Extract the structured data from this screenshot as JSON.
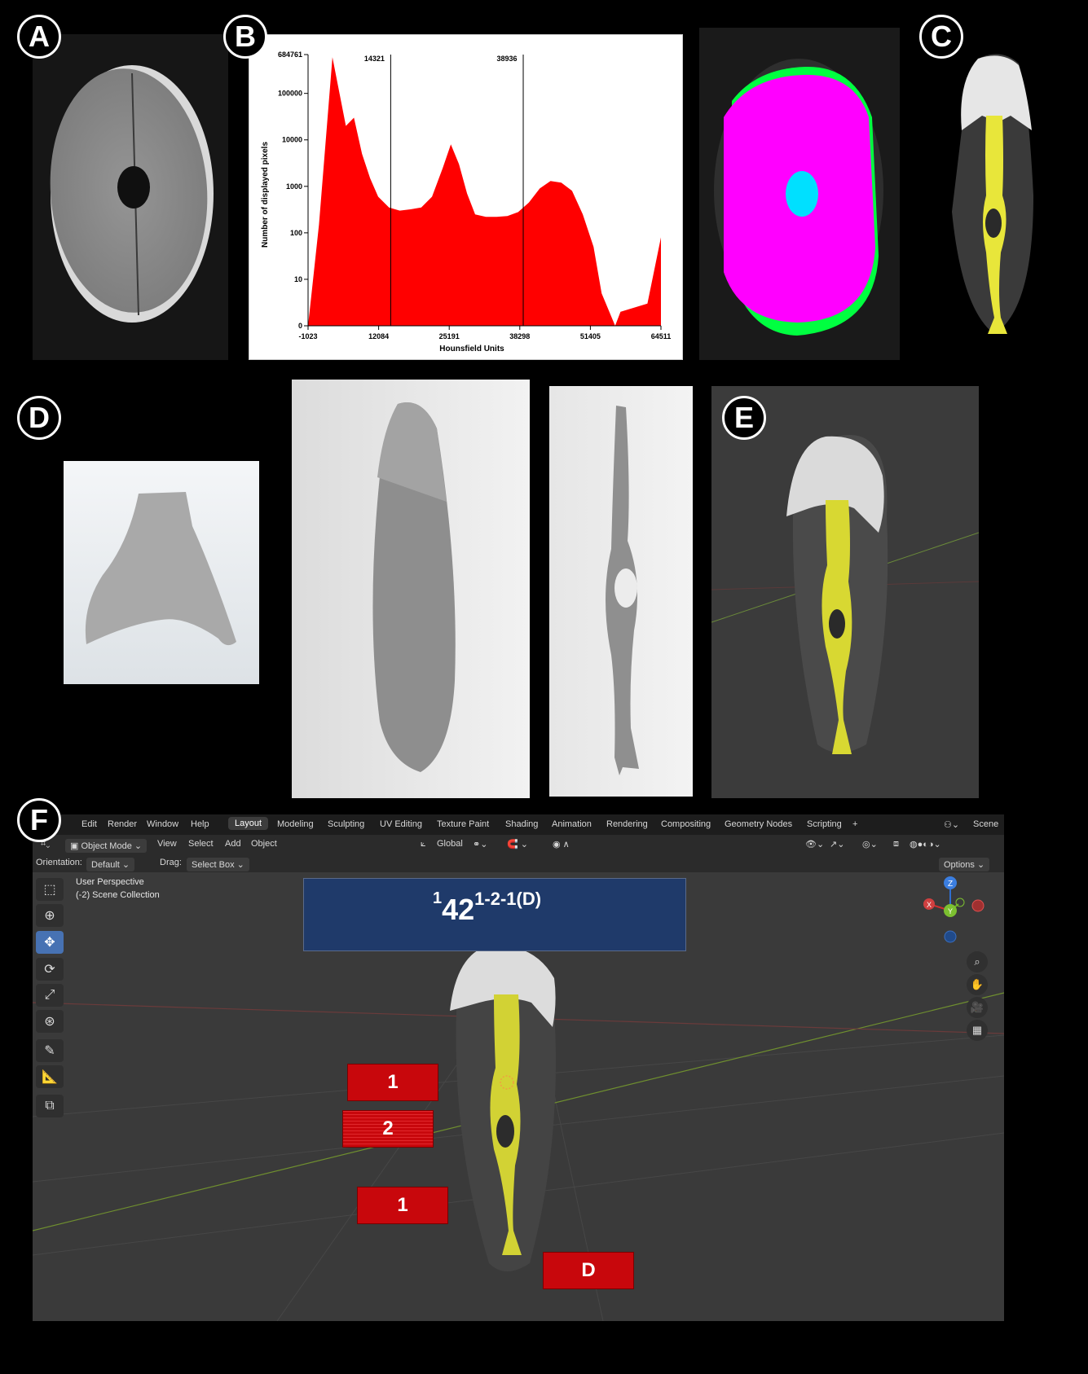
{
  "badges": {
    "a": "A",
    "b": "B",
    "c": "C",
    "d": "D",
    "e": "E",
    "f": "F"
  },
  "histogram": {
    "ylabel": "Number of displayed pixels",
    "xlabel": "Hounsfield Units",
    "y_ticks": [
      "684761",
      "100000",
      "10000",
      "1000",
      "100",
      "10",
      "0"
    ],
    "x_ticks": [
      "-1023",
      "12084",
      "25191",
      "38298",
      "51405",
      "64511"
    ],
    "thresholds": [
      "14321",
      "38936"
    ],
    "color": "#ff0000"
  },
  "chart_data": {
    "type": "area",
    "title": "",
    "xlabel": "Hounsfield Units",
    "ylabel": "Number of displayed pixels",
    "y_scale": "log",
    "xlim": [
      -1023,
      64511
    ],
    "ylim": [
      0,
      684761
    ],
    "x_ticks": [
      -1023,
      12084,
      25191,
      38298,
      51405,
      64511
    ],
    "y_ticks": [
      0,
      10,
      100,
      1000,
      10000,
      100000,
      684761
    ],
    "thresholds": [
      14321,
      38936
    ],
    "series": [
      {
        "x": [
          -1023,
          1000,
          3500,
          6000,
          7500,
          9000,
          10500,
          12000,
          14000,
          16000,
          18000,
          20000,
          22000,
          24000,
          25500,
          27000,
          28500,
          30000,
          32000,
          34000,
          36000,
          38000,
          40000,
          42000,
          44000,
          46000,
          48000,
          50000,
          52000,
          53500,
          56000,
          57000,
          62000,
          64511
        ],
        "y": [
          0,
          150,
          600000,
          20000,
          30000,
          5000,
          1500,
          600,
          350,
          300,
          320,
          350,
          600,
          2500,
          8000,
          3000,
          700,
          250,
          220,
          220,
          230,
          280,
          450,
          900,
          1300,
          1200,
          800,
          250,
          50,
          5,
          0,
          2,
          3,
          80
        ]
      }
    ],
    "color": "#ff0000"
  },
  "blender": {
    "menu": [
      "e",
      "Edit",
      "Render",
      "Window",
      "Help"
    ],
    "workspaces": [
      "Layout",
      "Modeling",
      "Sculpting",
      "UV Editing",
      "Texture Paint",
      "Shading",
      "Animation",
      "Rendering",
      "Compositing",
      "Geometry Nodes",
      "Scripting",
      "+"
    ],
    "scene_label": "Scene",
    "mode": "Object Mode",
    "header_menus": [
      "View",
      "Select",
      "Add",
      "Object"
    ],
    "transform_orientation": "Global",
    "orientation_label": "Orientation:",
    "orientation_value": "Default",
    "drag_label": "Drag:",
    "drag_value": "Select Box",
    "options_label": "Options",
    "viewport_title": "User Perspective",
    "viewport_collection": "(-2) Scene Collection",
    "gizmo": {
      "x": "X",
      "y": "Y",
      "z": "Z"
    },
    "annotation_title": {
      "base": "42",
      "pre": "1",
      "sup": "1-2-1(D)"
    },
    "labels": [
      "1",
      "2",
      "1",
      "D"
    ]
  }
}
